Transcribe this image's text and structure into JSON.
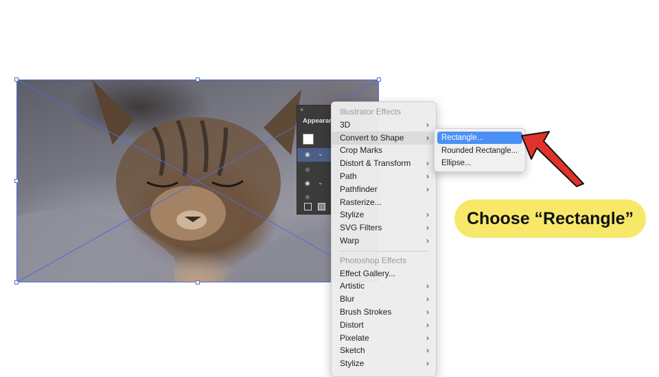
{
  "panel": {
    "close_glyph": "×",
    "title": "Appearan"
  },
  "menu": {
    "items": [
      {
        "label": "Illustrator Effects",
        "type": "header"
      },
      {
        "label": "3D",
        "submenu": true
      },
      {
        "label": "Convert to Shape",
        "submenu": true,
        "highlighted": true
      },
      {
        "label": "Crop Marks",
        "submenu": false
      },
      {
        "label": "Distort & Transform",
        "submenu": true
      },
      {
        "label": "Path",
        "submenu": true
      },
      {
        "label": "Pathfinder",
        "submenu": true
      },
      {
        "label": "Rasterize...",
        "submenu": false
      },
      {
        "label": "Stylize",
        "submenu": true
      },
      {
        "label": "SVG Filters",
        "submenu": true
      },
      {
        "label": "Warp",
        "submenu": true
      },
      {
        "label": "Photoshop Effects",
        "type": "header"
      },
      {
        "label": "Effect Gallery...",
        "submenu": false
      },
      {
        "label": "Artistic",
        "submenu": true
      },
      {
        "label": "Blur",
        "submenu": true
      },
      {
        "label": "Brush Strokes",
        "submenu": true
      },
      {
        "label": "Distort",
        "submenu": true
      },
      {
        "label": "Pixelate",
        "submenu": true
      },
      {
        "label": "Sketch",
        "submenu": true
      },
      {
        "label": "Stylize",
        "submenu": true
      }
    ]
  },
  "submenu": {
    "items": [
      {
        "label": "Rectangle...",
        "active": true
      },
      {
        "label": "Rounded Rectangle...",
        "active": false
      },
      {
        "label": "Ellipse...",
        "active": false
      }
    ]
  },
  "callout": {
    "text": "Choose “Rectangle”"
  },
  "colors": {
    "selection": "#4f6bd8",
    "submenu_active": "#4a90f5",
    "callout_bg": "#f7e86a",
    "arrow": "#e0322b"
  },
  "icons": {
    "submenu_arrow": "chevron-right-icon",
    "visibility": "eye-icon",
    "expand": "chevron-down-icon"
  }
}
